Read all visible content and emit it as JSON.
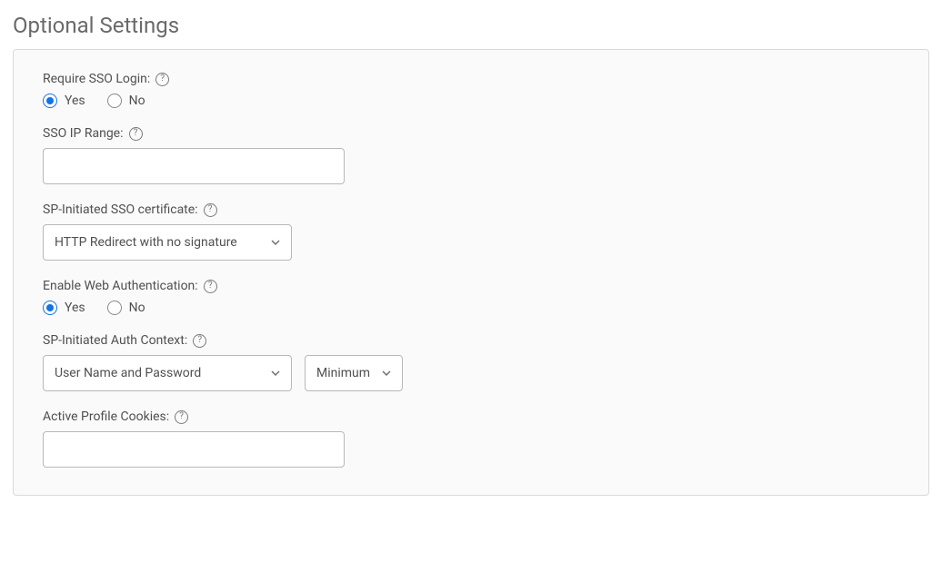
{
  "section_title": "Optional Settings",
  "yes_label": "Yes",
  "no_label": "No",
  "require_sso": {
    "label": "Require SSO Login:",
    "selected": "yes"
  },
  "sso_ip_range": {
    "label": "SSO IP Range:",
    "value": ""
  },
  "sp_cert": {
    "label": "SP-Initiated SSO certificate:",
    "selected": "HTTP Redirect with no signature"
  },
  "web_auth": {
    "label": "Enable Web Authentication:",
    "selected": "yes"
  },
  "auth_context": {
    "label": "SP-Initiated Auth Context:",
    "selected": "User Name and Password",
    "comparison": "Minimum"
  },
  "active_cookies": {
    "label": "Active Profile Cookies:",
    "value": ""
  }
}
